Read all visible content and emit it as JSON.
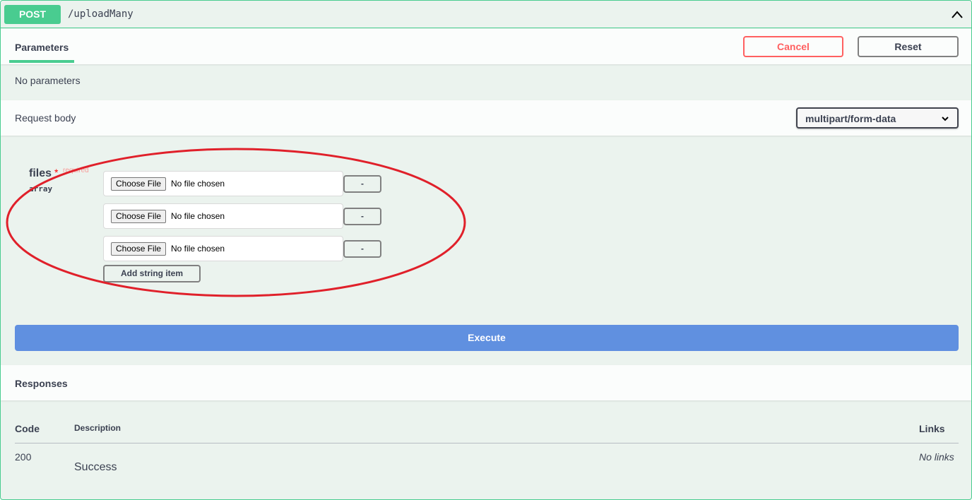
{
  "operation": {
    "method": "POST",
    "path": "/uploadMany"
  },
  "parameters": {
    "tab_label": "Parameters",
    "cancel_label": "Cancel",
    "reset_label": "Reset",
    "empty_text": "No parameters"
  },
  "request_body": {
    "label": "Request body",
    "content_type": "multipart/form-data",
    "field": {
      "name": "files",
      "required_marker": "*",
      "required_text": "required",
      "type": "array"
    },
    "file_inputs": [
      {
        "button": "Choose File",
        "status": "No file chosen",
        "remove": "-"
      },
      {
        "button": "Choose File",
        "status": "No file chosen",
        "remove": "-"
      },
      {
        "button": "Choose File",
        "status": "No file chosen",
        "remove": "-"
      }
    ],
    "add_item_label": "Add string item"
  },
  "execute_label": "Execute",
  "responses": {
    "label": "Responses",
    "headers": {
      "code": "Code",
      "description": "Description",
      "links": "Links"
    },
    "rows": [
      {
        "code": "200",
        "description": "Success",
        "links": "No links"
      }
    ]
  },
  "colors": {
    "post_green": "#49cc90",
    "panel_bg": "#ebf3ee",
    "execute_blue": "#6090e0",
    "cancel_red": "#ff6060",
    "annotation_red": "#e0202a"
  }
}
